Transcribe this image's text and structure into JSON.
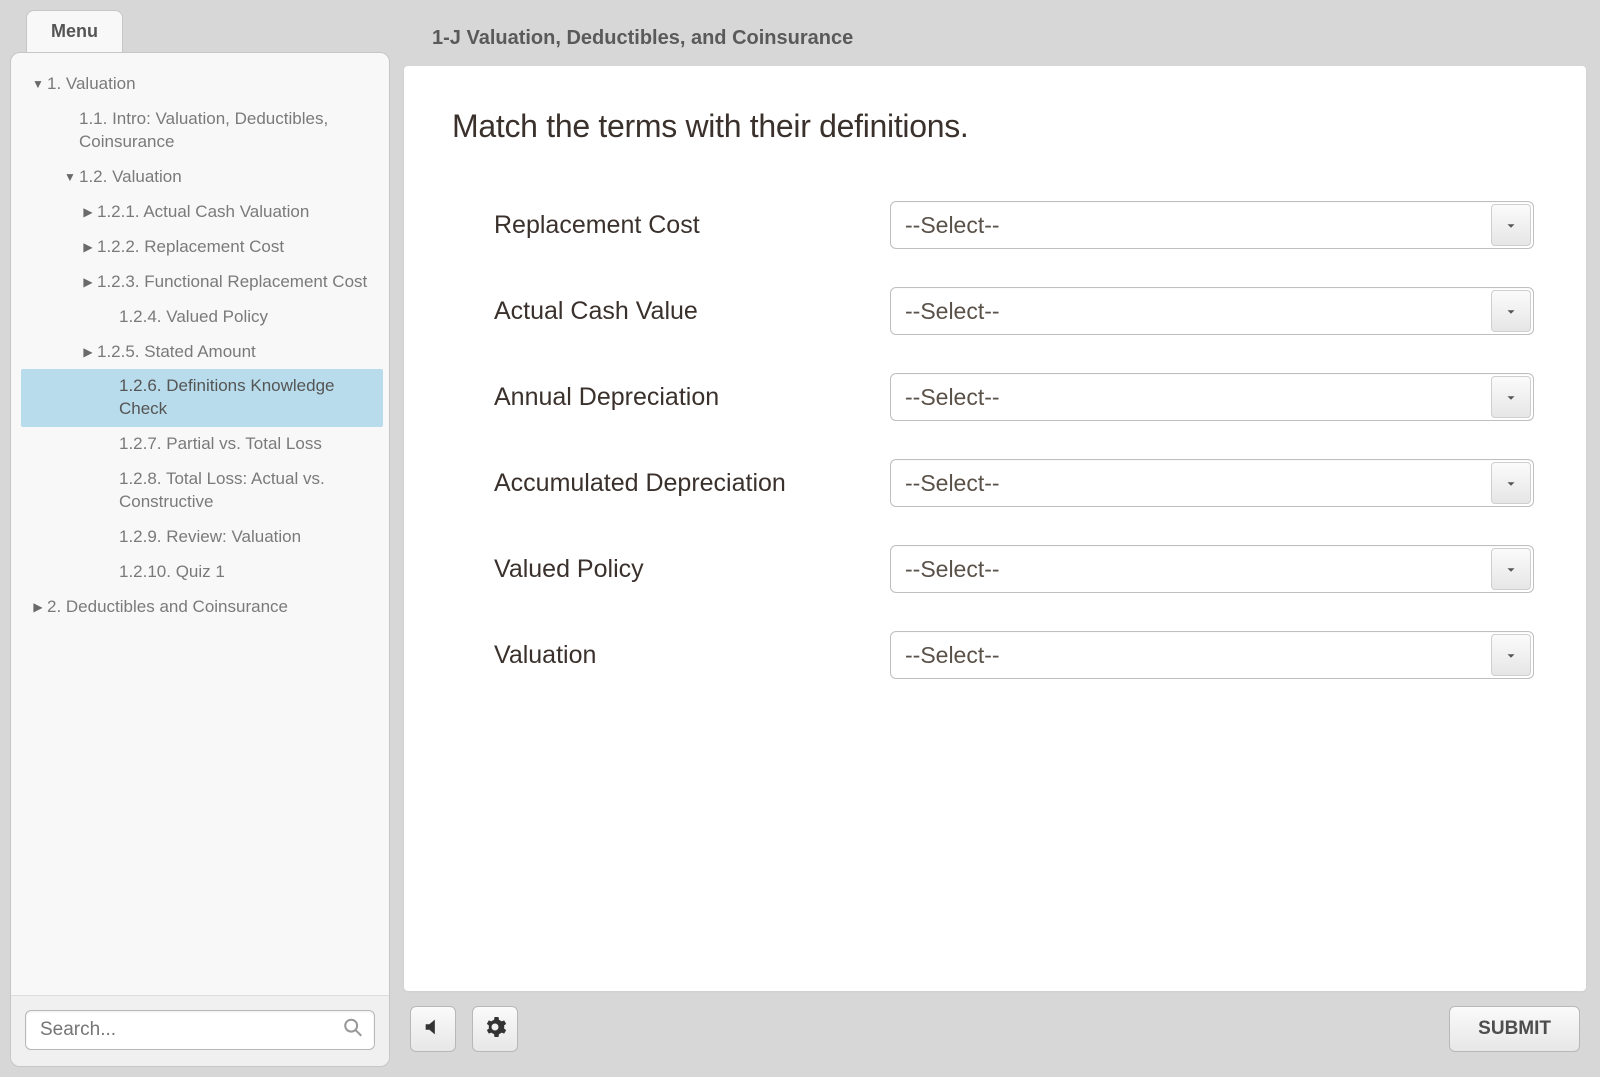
{
  "sidebar": {
    "tab_label": "Menu",
    "search_placeholder": "Search...",
    "items": [
      {
        "label": "1. Valuation",
        "caret": "down",
        "level": 0
      },
      {
        "label": "1.1. Intro: Valuation, Deductibles, Coinsurance",
        "caret": "",
        "level": 1
      },
      {
        "label": "1.2. Valuation",
        "caret": "down",
        "level": 1
      },
      {
        "label": "1.2.1. Actual Cash Valuation",
        "caret": "right",
        "level": 2
      },
      {
        "label": "1.2.2. Replacement Cost",
        "caret": "right",
        "level": 2
      },
      {
        "label": "1.2.3. Functional Replacement Cost",
        "caret": "right",
        "level": 2
      },
      {
        "label": "1.2.4. Valued Policy",
        "caret": "",
        "level": 3
      },
      {
        "label": "1.2.5. Stated Amount",
        "caret": "right",
        "level": 2
      },
      {
        "label": "1.2.6. Definitions Knowledge Check",
        "caret": "",
        "level": 3,
        "selected": true
      },
      {
        "label": "1.2.7. Partial vs. Total Loss",
        "caret": "",
        "level": 3
      },
      {
        "label": "1.2.8. Total Loss: Actual vs. Constructive",
        "caret": "",
        "level": 3
      },
      {
        "label": "1.2.9. Review: Valuation",
        "caret": "",
        "level": 3
      },
      {
        "label": "1.2.10. Quiz 1",
        "caret": "",
        "level": 3
      },
      {
        "label": "2. Deductibles and Coinsurance",
        "caret": "right",
        "level": 0
      }
    ]
  },
  "header": {
    "title": "1-J Valuation, Deductibles, and Coinsurance"
  },
  "question": {
    "prompt": "Match the terms with their definitions.",
    "select_placeholder": "--Select--",
    "terms": [
      "Replacement Cost",
      "Actual Cash Value",
      "Annual Depreciation",
      "Accumulated Depreciation",
      "Valued Policy",
      "Valuation"
    ]
  },
  "footer": {
    "submit_label": "SUBMIT"
  }
}
